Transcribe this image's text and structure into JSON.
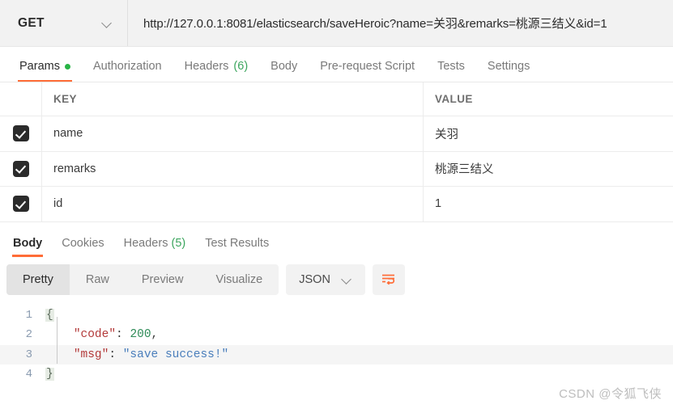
{
  "request": {
    "method": "GET",
    "method_icon": "chevron-down-icon",
    "url": "http://127.0.0.1:8081/elasticsearch/saveHeroic?name=关羽&remarks=桃源三结义&id=1"
  },
  "request_tabs": [
    {
      "label": "Params",
      "active": true,
      "dot": true
    },
    {
      "label": "Authorization",
      "active": false
    },
    {
      "label": "Headers",
      "count": "(6)",
      "active": false
    },
    {
      "label": "Body",
      "active": false
    },
    {
      "label": "Pre-request Script",
      "active": false
    },
    {
      "label": "Tests",
      "active": false
    },
    {
      "label": "Settings",
      "active": false
    }
  ],
  "params_table": {
    "headers": {
      "key": "KEY",
      "value": "VALUE"
    },
    "rows": [
      {
        "checked": true,
        "key": "name",
        "value": "关羽"
      },
      {
        "checked": true,
        "key": "remarks",
        "value": "桃源三结义"
      },
      {
        "checked": true,
        "key": "id",
        "value": "1"
      }
    ]
  },
  "response_tabs": [
    {
      "label": "Body",
      "active": true
    },
    {
      "label": "Cookies",
      "active": false
    },
    {
      "label": "Headers",
      "count": "(5)",
      "active": false
    },
    {
      "label": "Test Results",
      "active": false
    }
  ],
  "format_bar": {
    "modes": [
      {
        "label": "Pretty",
        "active": true
      },
      {
        "label": "Raw",
        "active": false
      },
      {
        "label": "Preview",
        "active": false
      },
      {
        "label": "Visualize",
        "active": false
      }
    ],
    "language": "JSON",
    "language_icon": "chevron-down-icon",
    "wrap_icon": "word-wrap-icon"
  },
  "response_body": {
    "lines": [
      {
        "no": "1",
        "open_brace": "{",
        "highlight": false
      },
      {
        "no": "2",
        "key": "\"code\"",
        "colon": ": ",
        "number": "200",
        "comma": ",",
        "highlight": false
      },
      {
        "no": "3",
        "key": "\"msg\"",
        "colon": ": ",
        "string": "\"save success!\"",
        "highlight": true
      },
      {
        "no": "4",
        "close_brace": "}",
        "highlight": false
      }
    ]
  },
  "watermark": "CSDN @令狐飞侠",
  "colors": {
    "accent": "#ff6c37",
    "green_dot": "#28b446",
    "count_green": "#3ba55d",
    "json_key": "#b33a3a",
    "json_number": "#2e8b57",
    "json_string": "#4a7ebb"
  }
}
